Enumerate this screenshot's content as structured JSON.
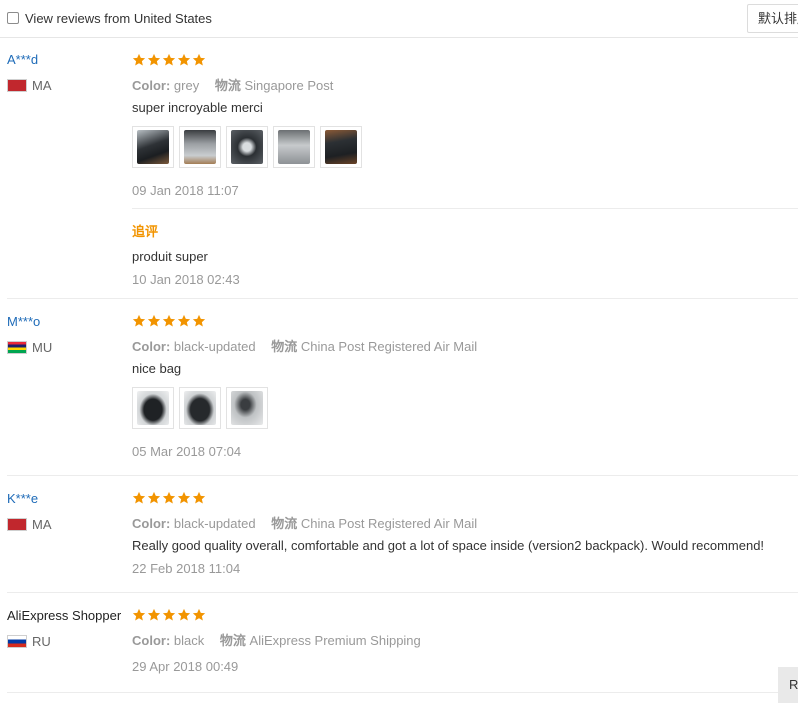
{
  "filter": {
    "label": "View reviews from United States",
    "checked": false
  },
  "sort": {
    "label": "默认排序"
  },
  "labels": {
    "color": "Color:",
    "logistics": "物流"
  },
  "star_color": "#f29400",
  "reviews": [
    {
      "buyer": "A***d",
      "country": "MA",
      "rating": 5,
      "color": "grey",
      "shipping": "Singapore Post",
      "text": "super incroyable merci",
      "photos": 5,
      "date": "09 Jan 2018 11:07",
      "additional": {
        "label": "追评",
        "text": "produit super",
        "date": "10 Jan 2018 02:43"
      }
    },
    {
      "buyer": "M***o",
      "country": "MU",
      "rating": 5,
      "color": "black-updated",
      "shipping": "China Post Registered Air Mail",
      "text": "nice bag",
      "photos": 3,
      "date": "05 Mar 2018 07:04"
    },
    {
      "buyer": "K***e",
      "country": "MA",
      "rating": 5,
      "color": "black-updated",
      "shipping": "China Post Registered Air Mail",
      "text": "Really good quality overall, comfortable and got a lot of space inside (version2 backpack). Would recommend!",
      "date": "22 Feb 2018 11:04"
    },
    {
      "buyer": "AliExpress Shopper",
      "country": "RU",
      "rating": 5,
      "color": "black",
      "shipping": "AliExpress Premium Shipping",
      "date": "29 Apr 2018 00:49"
    }
  ],
  "help_button": {
    "label": "R"
  }
}
